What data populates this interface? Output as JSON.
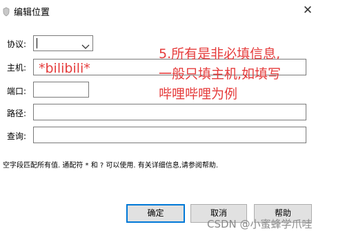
{
  "window": {
    "title": "编辑位置",
    "close_glyph": "✕",
    "title_icon": "shield-icon"
  },
  "form": {
    "protocol": {
      "label": "协议:",
      "value": "",
      "icon": "chevron-down-icon"
    },
    "host": {
      "label": "主机:",
      "value": ""
    },
    "port": {
      "label": "端口:",
      "value": ""
    },
    "path": {
      "label": "路径:",
      "value": ""
    },
    "query": {
      "label": "查询:",
      "value": ""
    }
  },
  "hint": "空字段匹配所有值. 通配符 * 和 ? 可以使用. 有关详细信息,请参阅帮助.",
  "buttons": {
    "ok": "确定",
    "cancel": "取消",
    "help": "帮助"
  },
  "annotations": {
    "host_example": "*bilibili*",
    "note_lines": [
      "5.所有是非必填信息,",
      "一般只填主机,如填写",
      "哔哩哔哩为例"
    ],
    "color": "#e53c3c"
  },
  "watermark": "CSDN @小蜜蜂学爪哇"
}
